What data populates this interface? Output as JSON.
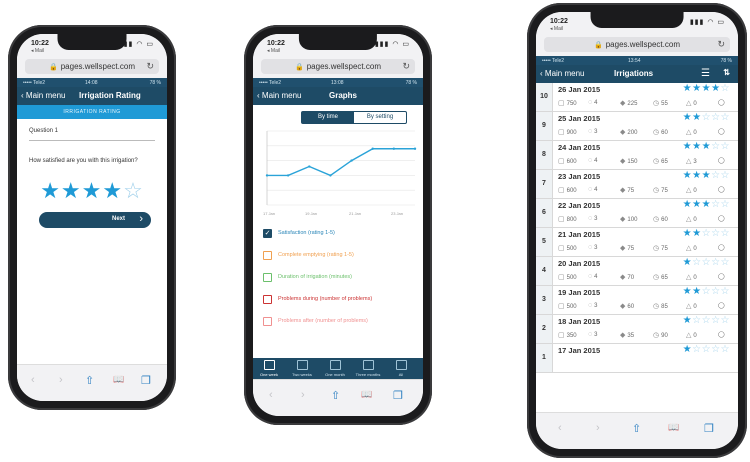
{
  "phones": [
    {
      "ios_time": "10:22",
      "ios_back": "◂ Mail",
      "url": "pages.wellspect.com",
      "carrier": "••••• Tele2",
      "app_time": "14:08",
      "battery": "78 %",
      "nav_back": "Main menu",
      "title": "Irrigation Rating",
      "banner": "IRRIGATION RATING",
      "question_label": "Question 1",
      "question": "How satisfied are you with this irrigation?",
      "rating_filled": "★★★★",
      "rating_empty": "☆",
      "next_label": "Next",
      "next_chevron": "›"
    },
    {
      "ios_time": "10:22",
      "ios_back": "◂ Mail",
      "url": "pages.wellspect.com",
      "carrier": "••••• Tele2",
      "app_time": "13:08",
      "battery": "78 %",
      "nav_back": "Main menu",
      "title": "Graphs",
      "segments": [
        "By time",
        "By setting"
      ],
      "x_ticks": [
        "17 Jan",
        "19 Jan",
        "21 Jan",
        "23 Jan"
      ],
      "legend": [
        {
          "label": "Satisfaction (rating 1-5)",
          "color": "#2a86b8",
          "checked": true
        },
        {
          "label": "Complete emptying (rating 1-5)",
          "color": "#f0a050",
          "checked": false
        },
        {
          "label": "Duration of irrigation (minutes)",
          "color": "#6cc06c",
          "checked": false
        },
        {
          "label": "Problems during (number of problems)",
          "color": "#cc3333",
          "checked": false
        },
        {
          "label": "Problems after (number of problems)",
          "color": "#f09090",
          "checked": false
        }
      ],
      "tabs": [
        "One week",
        "Two weeks",
        "One month",
        "Three months",
        "All"
      ],
      "chart_data": {
        "type": "line",
        "x": [
          "17 Jan",
          "18 Jan",
          "19 Jan",
          "20 Jan",
          "21 Jan",
          "22 Jan",
          "23 Jan",
          "24 Jan"
        ],
        "series": [
          {
            "name": "Satisfaction (rating 1-5)",
            "values": [
              2,
              2,
              2.6,
              2,
              3,
              3.8,
              3.8,
              3.8
            ]
          }
        ],
        "ylim": [
          0,
          5
        ],
        "grid": true
      }
    },
    {
      "ios_time": "10:22",
      "ios_back": "◂ Mail",
      "url": "pages.wellspect.com",
      "carrier": "••••• Tele2",
      "app_time": "13:54",
      "battery": "78 %",
      "nav_back": "Main menu",
      "title": "Irrigations",
      "rows": [
        {
          "idx": "10",
          "date": "26 Jan 2015",
          "stars": 4,
          "vol": "750",
          "drops": "4",
          "flow": "225",
          "min": "55",
          "warn": "0"
        },
        {
          "idx": "9",
          "date": "25 Jan 2015",
          "stars": 2,
          "vol": "900",
          "drops": "3",
          "flow": "200",
          "min": "60",
          "warn": "0"
        },
        {
          "idx": "8",
          "date": "24 Jan 2015",
          "stars": 3,
          "vol": "600",
          "drops": "4",
          "flow": "150",
          "min": "65",
          "warn": "3"
        },
        {
          "idx": "7",
          "date": "23 Jan 2015",
          "stars": 3,
          "vol": "600",
          "drops": "4",
          "flow": "75",
          "min": "75",
          "warn": "0"
        },
        {
          "idx": "6",
          "date": "22 Jan 2015",
          "stars": 3,
          "vol": "800",
          "drops": "3",
          "flow": "100",
          "min": "60",
          "warn": "0"
        },
        {
          "idx": "5",
          "date": "21 Jan 2015",
          "stars": 2,
          "vol": "500",
          "drops": "3",
          "flow": "75",
          "min": "75",
          "warn": "0"
        },
        {
          "idx": "4",
          "date": "20 Jan 2015",
          "stars": 1,
          "vol": "500",
          "drops": "4",
          "flow": "70",
          "min": "65",
          "warn": "0"
        },
        {
          "idx": "3",
          "date": "19 Jan 2015",
          "stars": 2,
          "vol": "500",
          "drops": "3",
          "flow": "60",
          "min": "85",
          "warn": "0"
        },
        {
          "idx": "2",
          "date": "18 Jan 2015",
          "stars": 1,
          "vol": "350",
          "drops": "3",
          "flow": "35",
          "min": "90",
          "warn": "0"
        },
        {
          "idx": "1",
          "date": "17 Jan 2015",
          "stars": 1,
          "vol": "",
          "drops": "",
          "flow": "",
          "min": "",
          "warn": ""
        }
      ]
    }
  ],
  "icons": {
    "lock": "🔒",
    "reload": "↻",
    "back": "‹",
    "share": "⇧",
    "book": "📖",
    "tabs": "❐",
    "prev": "‹",
    "next": "›",
    "menu": "☰",
    "sort": "⇅"
  }
}
